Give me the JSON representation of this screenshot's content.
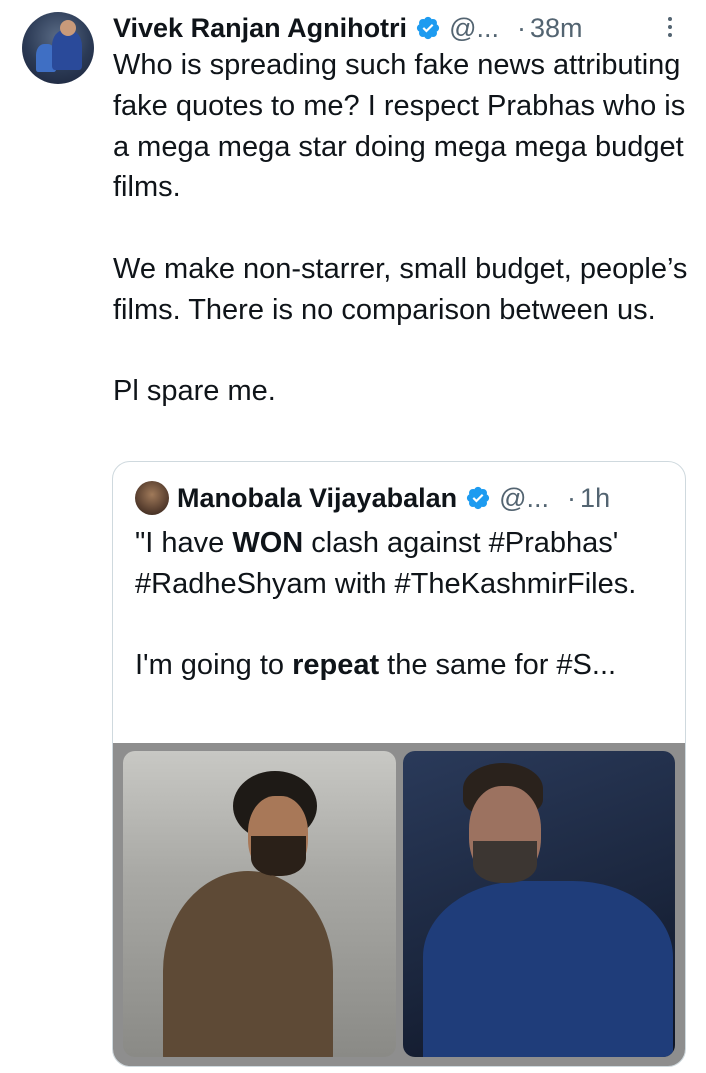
{
  "tweet": {
    "author_name": "Vivek Ranjan Agnihotri",
    "handle": "@...",
    "separator": "·",
    "time": "38m",
    "paragraphs": [
      "Who is spreading such fake news attributing fake quotes to me? I respect Prabhas who is a mega mega star doing mega mega budget films.",
      "We make non-starrer, small budget, people’s films. There is no comparison between us.",
      "Pl spare me."
    ]
  },
  "quoted_tweet": {
    "author_name": "Manobala Vijayabalan",
    "handle": "@...",
    "separator": "·",
    "time": "1h",
    "line1_pre": "\"I have ",
    "line1_bold": "WON",
    "line1_post": " clash against #Prabhas' #RadheShyam with #TheKashmirFiles.",
    "line2_pre": "I'm going to ",
    "line2_bold": "repeat",
    "line2_post": " the same for #S..."
  },
  "colors": {
    "verified": "#1d9bf0",
    "secondary_text": "#536471",
    "primary_text": "#0f1419",
    "border": "#cfd9de"
  },
  "icons": {
    "verified": "verified-badge-icon",
    "more": "more-vertical-icon"
  }
}
